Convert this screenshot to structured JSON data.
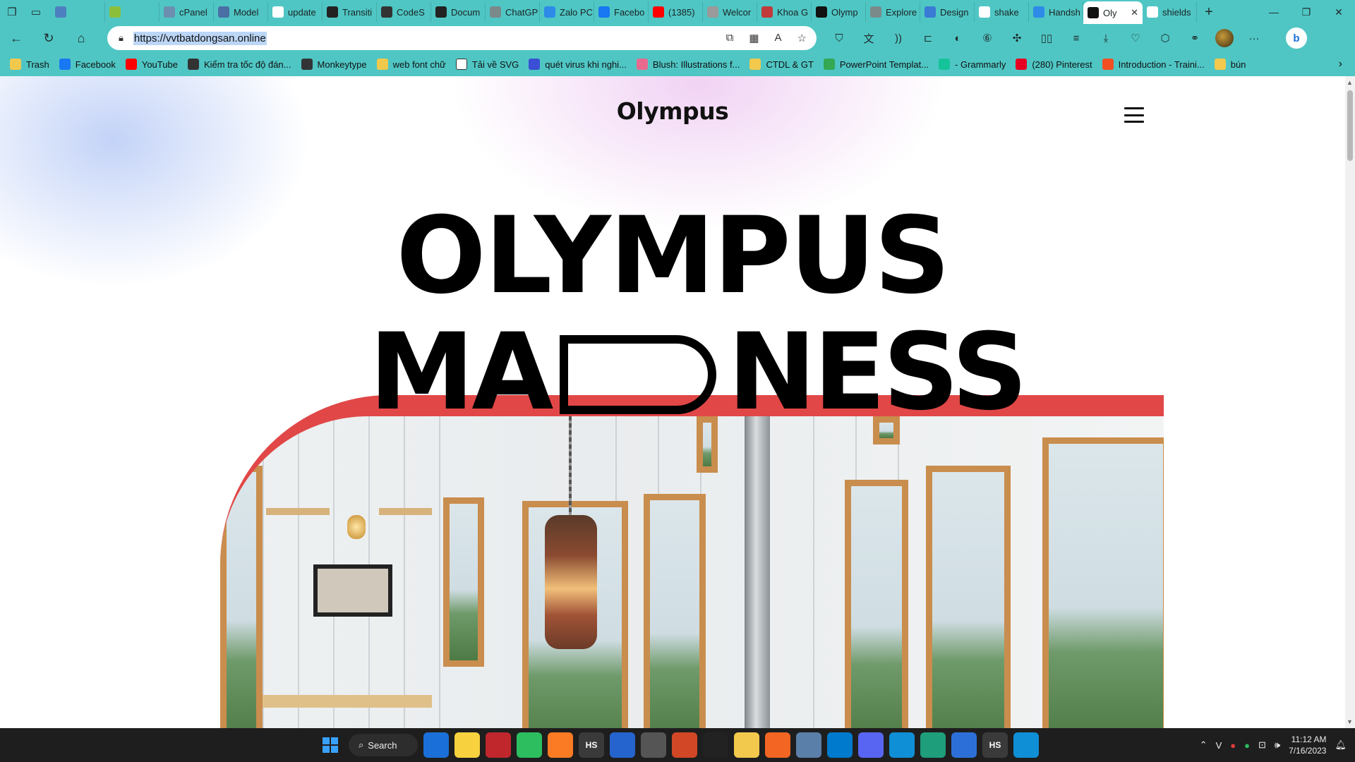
{
  "browser": {
    "tabs": [
      {
        "title": "",
        "icon": "pin-icon",
        "color": "#4c7fbf"
      },
      {
        "title": "",
        "icon": "n-icon",
        "color": "#8bbf3b"
      },
      {
        "title": "cPanel",
        "icon": "cpanel-icon",
        "color": "#6c8fb0"
      },
      {
        "title": "Model",
        "icon": "model-icon",
        "color": "#4a6fa5"
      },
      {
        "title": "update",
        "icon": "google-icon",
        "color": "#ffffff"
      },
      {
        "title": "Transiti",
        "icon": "framer-icon",
        "color": "#222222"
      },
      {
        "title": "CodeS",
        "icon": "code-icon",
        "color": "#333333"
      },
      {
        "title": "Docum",
        "icon": "framer-icon",
        "color": "#222222"
      },
      {
        "title": "ChatGP",
        "icon": "openai-icon",
        "color": "#7a8a8a"
      },
      {
        "title": "Zalo PC",
        "icon": "zalo-icon",
        "color": "#2d8ae8"
      },
      {
        "title": "Facebo",
        "icon": "facebook-icon",
        "color": "#1877f2"
      },
      {
        "title": "(1385)",
        "icon": "youtube-icon",
        "color": "#ff0000"
      },
      {
        "title": "Welcor",
        "icon": "welcome-icon",
        "color": "#9a9a9a"
      },
      {
        "title": "Khoa G",
        "icon": "khoa-icon",
        "color": "#c23a3a"
      },
      {
        "title": "Olymp",
        "icon": "olympus-icon",
        "color": "#111111"
      },
      {
        "title": "Explore",
        "icon": "openai-icon",
        "color": "#7a8a8a"
      },
      {
        "title": "Design",
        "icon": "design-icon",
        "color": "#3a7bd5"
      },
      {
        "title": "shake",
        "icon": "google-icon",
        "color": "#ffffff"
      },
      {
        "title": "Handsh",
        "icon": "search-icon",
        "color": "#2d8ae8"
      },
      {
        "title": "Oly",
        "icon": "olympus-icon",
        "color": "#111111",
        "active": true
      },
      {
        "title": "shields",
        "icon": "google-icon",
        "color": "#ffffff"
      }
    ],
    "new_tab_label": "+",
    "url": "https://vvtbatdongsan.online",
    "bookmarks": [
      {
        "label": "Trash",
        "icon": "folder-icon",
        "color": "#f2c94c"
      },
      {
        "label": "Facebook",
        "icon": "facebook-icon",
        "color": "#1877f2"
      },
      {
        "label": "YouTube",
        "icon": "youtube-icon",
        "color": "#ff0000"
      },
      {
        "label": "Kiểm tra tốc độ đán...",
        "icon": "speed-icon",
        "color": "#333333"
      },
      {
        "label": "Monkeytype",
        "icon": "monkeytype-icon",
        "color": "#323437"
      },
      {
        "label": "web font chữ",
        "icon": "folder-icon",
        "color": "#f2c94c"
      },
      {
        "label": "Tải về SVG",
        "icon": "file-icon",
        "color": "#ffffff"
      },
      {
        "label": "quét virus khi nghi...",
        "icon": "virus-scan-icon",
        "color": "#3a4fd5"
      },
      {
        "label": "Blush: Illustrations f...",
        "icon": "blush-icon",
        "color": "#e86a8e"
      },
      {
        "label": "CTDL & GT",
        "icon": "folder-icon",
        "color": "#f2c94c"
      },
      {
        "label": "PowerPoint Templat...",
        "icon": "drive-icon",
        "color": "#34a853"
      },
      {
        "label": "- Grammarly",
        "icon": "grammarly-icon",
        "color": "#15c39a"
      },
      {
        "label": "(280) Pinterest",
        "icon": "pinterest-icon",
        "color": "#e60023"
      },
      {
        "label": "Introduction - Traini...",
        "icon": "microsoft-icon",
        "color": "#f25022"
      },
      {
        "label": "bún",
        "icon": "folder-icon",
        "color": "#f2c94c"
      }
    ]
  },
  "page": {
    "logo": "Olympus",
    "hero_line1": "OLYMPUS",
    "hero_line2_left": "MA",
    "hero_line2_right": "NESS",
    "accent_color": "#e14747"
  },
  "taskbar": {
    "search_label": "Search",
    "apps": [
      {
        "name": "edge-dev-icon",
        "label": "",
        "color": "#1b6fd8"
      },
      {
        "name": "sticky-notes-icon",
        "label": "",
        "color": "#f7d23e"
      },
      {
        "name": "app-red-icon",
        "label": "",
        "color": "#c0272d"
      },
      {
        "name": "evernote-icon",
        "label": "",
        "color": "#2dbe60"
      },
      {
        "name": "xampp-icon",
        "label": "",
        "color": "#fb7a24"
      },
      {
        "name": "hs-icon",
        "label": "HS",
        "color": "#3a3a3a"
      },
      {
        "name": "todo-icon",
        "label": "",
        "color": "#2564cf"
      },
      {
        "name": "postman-icon",
        "label": "",
        "color": "#555555"
      },
      {
        "name": "powerpoint-icon",
        "label": "",
        "color": "#d24726"
      },
      {
        "name": "ryzen-icon",
        "label": "",
        "color": "#222222"
      },
      {
        "name": "file-explorer-icon",
        "label": "",
        "color": "#f2c94c"
      },
      {
        "name": "orange-app-icon",
        "label": "",
        "color": "#f26522"
      },
      {
        "name": "chart-app-icon",
        "label": "",
        "color": "#5a7fa8"
      },
      {
        "name": "vscode-icon",
        "label": "",
        "color": "#007acc"
      },
      {
        "name": "discord-icon",
        "label": "",
        "color": "#5865f2"
      },
      {
        "name": "edge-icon",
        "label": "",
        "color": "#0f8fd6"
      },
      {
        "name": "shield-app-icon",
        "label": "",
        "color": "#1e9e7a"
      },
      {
        "name": "translator-icon",
        "label": "",
        "color": "#2d6fd8"
      },
      {
        "name": "hs-icon",
        "label": "HS",
        "color": "#3a3a3a"
      },
      {
        "name": "edge-icon",
        "label": "",
        "color": "#0f8fd6"
      }
    ],
    "time": "11:12 AM",
    "date": "7/16/2023"
  }
}
